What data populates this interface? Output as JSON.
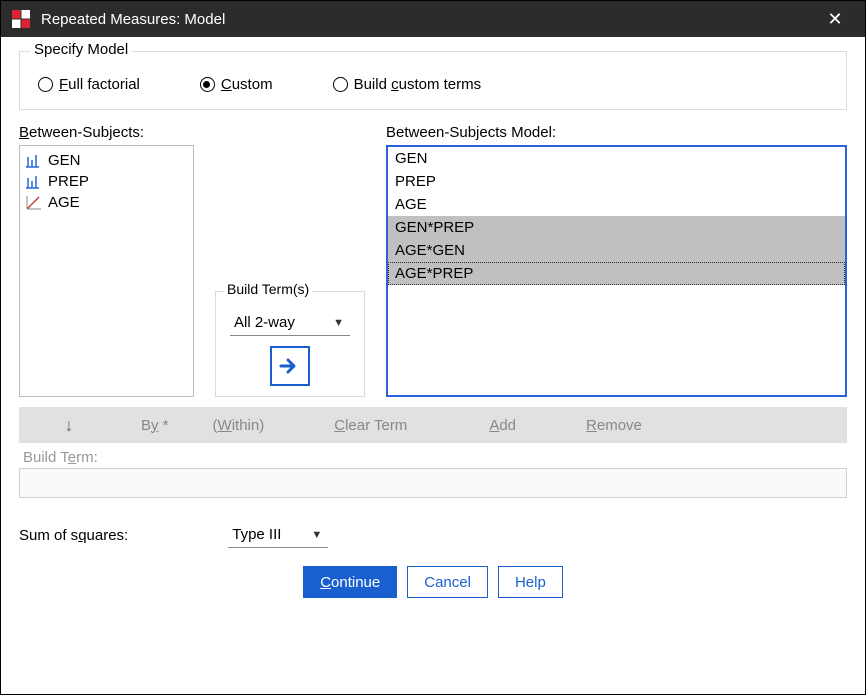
{
  "title": "Repeated Measures: Model",
  "specify_model": {
    "group_label": "Specify Model",
    "full_factorial": "Full factorial",
    "custom": "Custom",
    "build_custom": "Build custom terms",
    "selected": "custom"
  },
  "left": {
    "label": "Between-Subjects:",
    "items": [
      {
        "type": "nominal",
        "text": "GEN"
      },
      {
        "type": "nominal",
        "text": "PREP"
      },
      {
        "type": "scale",
        "text": "AGE"
      }
    ]
  },
  "build_terms": {
    "box_title": "Build Term(s)",
    "interaction": "All 2-way"
  },
  "right": {
    "label": "Between-Subjects Model:",
    "items": [
      {
        "text": "GEN",
        "sel": false,
        "focused": false
      },
      {
        "text": "PREP",
        "sel": false,
        "focused": false
      },
      {
        "text": "AGE",
        "sel": false,
        "focused": false
      },
      {
        "text": "GEN*PREP",
        "sel": true,
        "focused": false
      },
      {
        "text": "AGE*GEN",
        "sel": true,
        "focused": false
      },
      {
        "text": "AGE*PREP",
        "sel": true,
        "focused": true
      }
    ]
  },
  "termbar": {
    "by": "By *",
    "within": "(Within)",
    "clear": "Clear Term",
    "add": "Add",
    "remove": "Remove"
  },
  "build_term_label": "Build Term:",
  "sum_squares": {
    "label": "Sum of squares:",
    "value": "Type III"
  },
  "buttons": {
    "continue": "Continue",
    "cancel": "Cancel",
    "help": "Help"
  }
}
